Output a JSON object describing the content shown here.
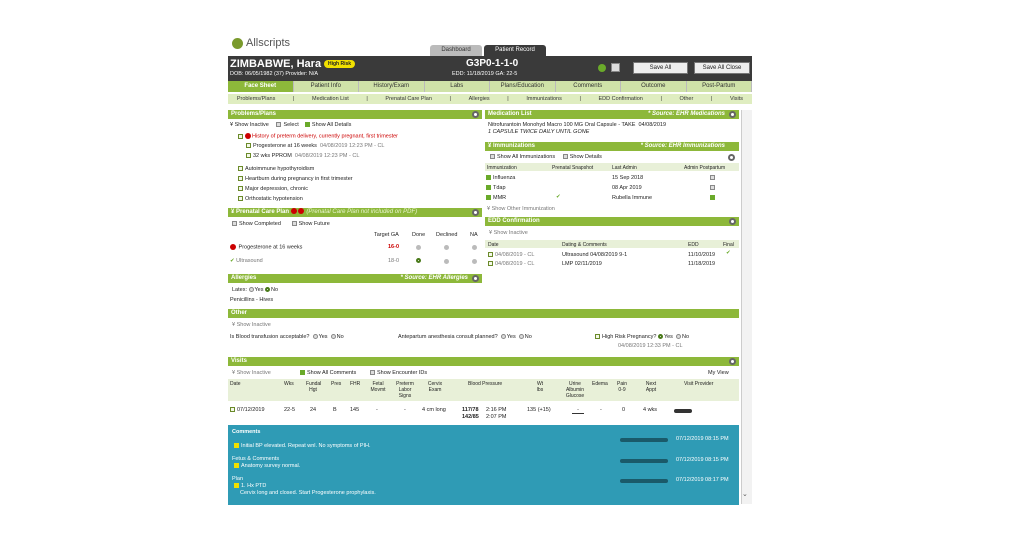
{
  "app": {
    "logo": "Allscripts"
  },
  "top_tabs": {
    "dashboard": "Dashboard",
    "patient_record": "Patient Record"
  },
  "patient": {
    "name": "ZIMBABWE, Hara",
    "risk_badge": "High Risk",
    "dob_line": "DOB: 06/05/1982 (37)    Provider: N/A",
    "gp": "G3P0-1-1-0",
    "edd_line": "EDD: 11/18/2019  GA: 22-5"
  },
  "buttons": {
    "save_all": "Save All",
    "save_all_close": "Save All Close"
  },
  "nav_tabs": [
    "Face Sheet",
    "Patient Info",
    "History/Exam",
    "Labs",
    "Plans/Education",
    "Comments",
    "Outcome",
    "Post-Partum"
  ],
  "sub_nav": [
    "Problems/Plans",
    "|",
    "Medication List",
    "|",
    "Prenatal Care Plan",
    "|",
    "Allergies",
    "|",
    "Immunizations",
    "|",
    "EDD Confirmation",
    "|",
    "Other",
    "|",
    "Visits"
  ],
  "problems": {
    "title": "Problems/Plans",
    "show_inactive": "Show Inactive",
    "select": "Select",
    "show_all_details": "Show All Details",
    "items": [
      "History of preterm delivery, currently pregnant, first trimester",
      "Progesterone at 16 weeks",
      "04/08/2019 12:23 PM - CL",
      "32 wks PPROM",
      "04/08/2019 12:23 PM - CL",
      "Autoimmune hypothyroidism",
      "Heartburn during pregnancy in first trimester",
      "Major depression, chronic",
      "Orthostatic hypotension"
    ]
  },
  "prenatal": {
    "title": "Prenatal Care Plan",
    "warning": "(Prenatal Care Plan not included on PDF)",
    "show_completed": "Show Completed",
    "show_future": "Show Future",
    "cols": [
      "Target GA",
      "Done",
      "Declined",
      "NA"
    ],
    "rows": [
      {
        "name": "Progesterone at 16 weeks",
        "ga": "16-0"
      },
      {
        "name": "Ultrasound",
        "ga": "18-0"
      }
    ]
  },
  "allergies": {
    "title": "Allergies",
    "source": "* Source: EHR Allergies",
    "latex": "Latex:",
    "yes": "Yes",
    "no": "No",
    "penicillin": "Penicillins  - Hives"
  },
  "other": {
    "title": "Other",
    "show_inactive": "Show Inactive",
    "q1": "Is Blood transfusion acceptable?",
    "q2": "Antepartum anesthesia consult planned?",
    "q3": "High Risk Pregnancy?",
    "q3_date": "04/08/2019 12:33 PM - CL",
    "yes": "Yes",
    "no": "No"
  },
  "medication": {
    "title": "Medication List",
    "source": "* Source: EHR Medications",
    "line1": "Nitrofurantoin Monohyd Macro 100 MG Oral Capsule - TAKE",
    "date": "04/08/2019",
    "line2": "1 CAPSULE TWICE DAILY UNTIL GONE"
  },
  "immunizations": {
    "title": "Immunizations",
    "source": "* Source: EHR Immunizations",
    "show_all": "Show All Immunizations",
    "show_details": "Show Details",
    "cols": [
      "Immunization",
      "Prenatal Snapshot",
      "Last Admin",
      "Admin Postpartum"
    ],
    "rows": [
      {
        "name": "Influenza",
        "date": "15 Sep 2018"
      },
      {
        "name": "Tdap",
        "date": "08 Apr 2019"
      },
      {
        "name": "MMR",
        "date": "Rubella Immune"
      }
    ],
    "show_other": "Show Other Immunization"
  },
  "edd": {
    "title": "EDD Confirmation",
    "show_inactive": "Show Inactive",
    "cols": [
      "Date",
      "Dating & Comments",
      "EDD",
      "Final"
    ],
    "rows": [
      {
        "date": "04/08/2019 - CL",
        "comment": "Ultrasound 04/08/2019 9-1",
        "edd": "11/10/2019"
      },
      {
        "date": "04/08/2019 - CL",
        "comment": "LMP 02/11/2019",
        "edd": "11/18/2019"
      }
    ]
  },
  "visits": {
    "title": "Visits",
    "show_inactive": "Show Inactive",
    "show_all_comments": "Show All Comments",
    "show_encounter": "Show Encounter IDs",
    "my_view": "My View",
    "cols": [
      "Date",
      "Wks",
      "Fundal Hgt",
      "Pres",
      "FHR",
      "Fetal Movmt",
      "Preterm Labor Signs",
      "Cervix Exam",
      "Blood Pressure",
      "Wt lbs",
      "Urine Albumin Glucose",
      "Edema",
      "Pain 0-9",
      "Next Appt",
      "Visit Provider"
    ],
    "row": {
      "date": "07/12/2019",
      "wks": "22-5",
      "fh": "24",
      "pres": "B",
      "fhr": "145",
      "fm": "-",
      "pl": "-",
      "cx": "4 cm long",
      "bp1": "117/78",
      "bp1t": "2:16 PM",
      "bp2": "142/85",
      "bp2t": "2:07 PM",
      "wt": "135 (+15)",
      "urine": "-",
      "edema": "-",
      "pain": "0",
      "next": "4 wks"
    }
  },
  "comments": {
    "title": "Comments",
    "c1": "Initial BP elevated. Repeat wnl. No symptoms of PIH.",
    "fetus": "Fetus & Comments",
    "c2": "Anatomy survey normal.",
    "plan": "Plan",
    "c3a": "1. Hx PTD",
    "c3b": "Cervix long and closed. Start Progesterone prophylaxis.",
    "t1": "07/12/2019 08:15 PM",
    "t2": "07/12/2019 08:15 PM",
    "t3": "07/12/2019 08:17 PM"
  },
  "colors": {
    "accent": "#8db83a",
    "header": "#3a3a3a",
    "comments_bg": "#2f9bb5"
  }
}
